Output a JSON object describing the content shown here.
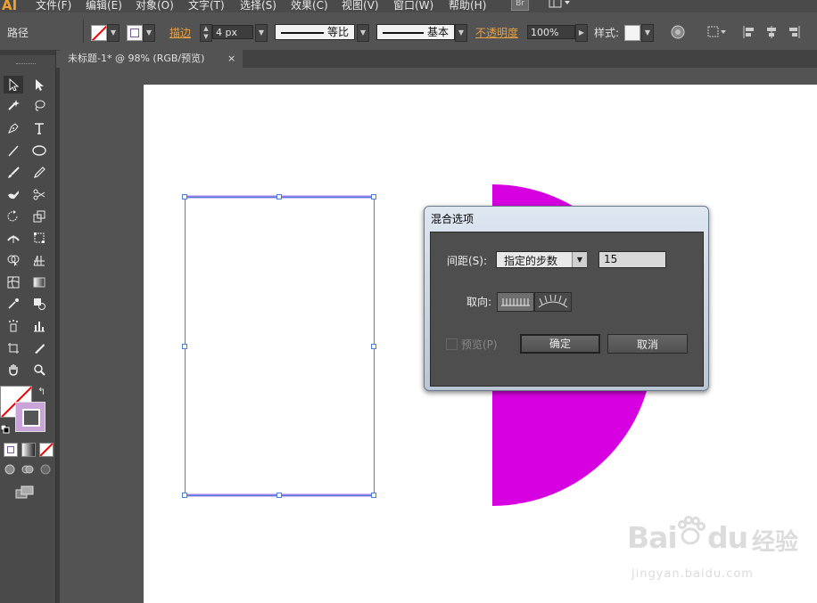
{
  "menubar": {
    "logo": "AI",
    "items": [
      "文件(F)",
      "编辑(E)",
      "对象(O)",
      "文字(T)",
      "选择(S)",
      "效果(C)",
      "视图(V)",
      "窗口(W)",
      "帮助(H)"
    ],
    "bridge_badge": "Br"
  },
  "control_bar": {
    "object_type": "路径",
    "stroke_link": "描边",
    "stroke_weight": "4 px",
    "profile": "等比",
    "brush": "基本",
    "opacity_link": "不透明度",
    "opacity_value": "100%",
    "style_label": "样式:"
  },
  "document_tab": {
    "title": "未标题-1* @ 98% (RGB/预览)",
    "close": "×"
  },
  "dialog": {
    "title": "混合选项",
    "spacing_label": "间距(S):",
    "spacing_option": "指定的步数",
    "steps_value": "15",
    "orientation_label": "取向:",
    "preview_label": "预览(P)",
    "preview_checked": false,
    "ok_label": "确定",
    "cancel_label": "取消"
  },
  "artwork": {
    "semicircle_color": "#d700e0",
    "path_stroke_color": "#9c7fe8",
    "selection_color": "#4a7fd8"
  },
  "colors": {
    "fill_swatch": "#c9a3d9",
    "stroke_swatch": "#7c5aa0"
  },
  "watermark": {
    "brand_latin": "Bai",
    "brand_suffix": "du",
    "brand_cn": "经验",
    "url": "jingyan.baidu.com"
  }
}
